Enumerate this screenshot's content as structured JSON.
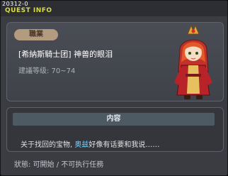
{
  "window": {
    "quest_id": "20312-0",
    "title": "QUEST INFO"
  },
  "quest": {
    "job_label": "職業",
    "name": "[希納斯騎士团] 神兽的眼泪",
    "level_requirement": "建議等级: 70~74"
  },
  "content": {
    "header": "内容",
    "text_before": "关于找回的宝物, ",
    "highlight_name": "奥兹",
    "text_after": "好像有话要和我说……"
  },
  "status": {
    "text": "狀態: 可開始 / 不可执行任務"
  },
  "colors": {
    "title_accent": "#d9dd4a",
    "job_badge": "#b39b80",
    "highlight": "#6fd3ff"
  },
  "icons": {
    "npc": "red-haired-mage-npc-portrait"
  }
}
